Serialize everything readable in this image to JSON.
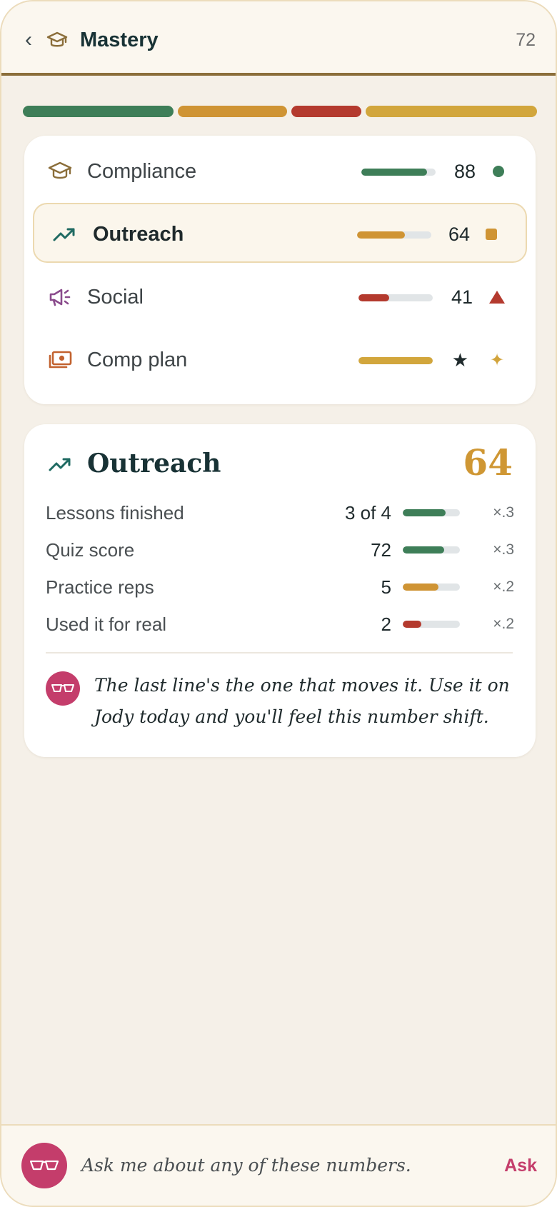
{
  "header": {
    "back_glyph": "‹",
    "title": "Mastery",
    "score": "72",
    "icon": "graduation-cap-icon"
  },
  "summary_stripe": [
    {
      "name": "Compliance",
      "value": 88,
      "color": "#3e7e58"
    },
    {
      "name": "Outreach",
      "value": 64,
      "color": "#cf9434"
    },
    {
      "name": "Social",
      "value": 41,
      "color": "#b43a2e"
    },
    {
      "name": "Comp plan",
      "value": 100,
      "color": "#d2a63c"
    }
  ],
  "categories": [
    {
      "label": "Compliance",
      "icon": "graduation-cap-icon",
      "score": "88",
      "progress": 0.88,
      "bar_color": "#3e7e58",
      "status": "dot",
      "status_color": "#3e7e58",
      "selected": false
    },
    {
      "label": "Outreach",
      "icon": "trending-up-icon",
      "score": "64",
      "progress": 0.64,
      "bar_color": "#cf9434",
      "status": "square",
      "status_color": "#cf9434",
      "selected": true
    },
    {
      "label": "Social",
      "icon": "megaphone-icon",
      "score": "41",
      "progress": 0.41,
      "bar_color": "#b43a2e",
      "status": "triangle",
      "status_color": "#b43a2e",
      "selected": false
    },
    {
      "label": "Comp plan",
      "icon": "money-icon",
      "score": "★",
      "progress": 1.0,
      "bar_color": "#d2a63c",
      "status": "sparkle",
      "status_glyph": "✦",
      "status_color": "#d2a43c",
      "selected": false
    }
  ],
  "detail": {
    "title": "Outreach",
    "score": "64",
    "icon": "trending-up-icon",
    "metrics": [
      {
        "label": "Lessons finished",
        "value": "3 of 4",
        "progress": 0.75,
        "color": "#3e7e58",
        "weight": "×.3"
      },
      {
        "label": "Quiz score",
        "value": "72",
        "progress": 0.72,
        "color": "#3e7e58",
        "weight": "×.3"
      },
      {
        "label": "Practice reps",
        "value": "5",
        "progress": 0.62,
        "color": "#cf9434",
        "weight": "×.2"
      },
      {
        "label": "Used it for real",
        "value": "2",
        "progress": 0.32,
        "color": "#b43a2e",
        "weight": "×.2"
      }
    ],
    "coach_quote": "The last line's the one that moves it. Use it on Jody today and you'll feel this number shift."
  },
  "ask_bar": {
    "placeholder": "Ask me about any of these numbers.",
    "button_label": "Ask",
    "avatar_icon": "glasses-icon"
  },
  "colors": {
    "background": "#f5f0e8",
    "accent": "#c43d6b",
    "header_rule": "#8b6e3a",
    "gold": "#cf9734"
  }
}
